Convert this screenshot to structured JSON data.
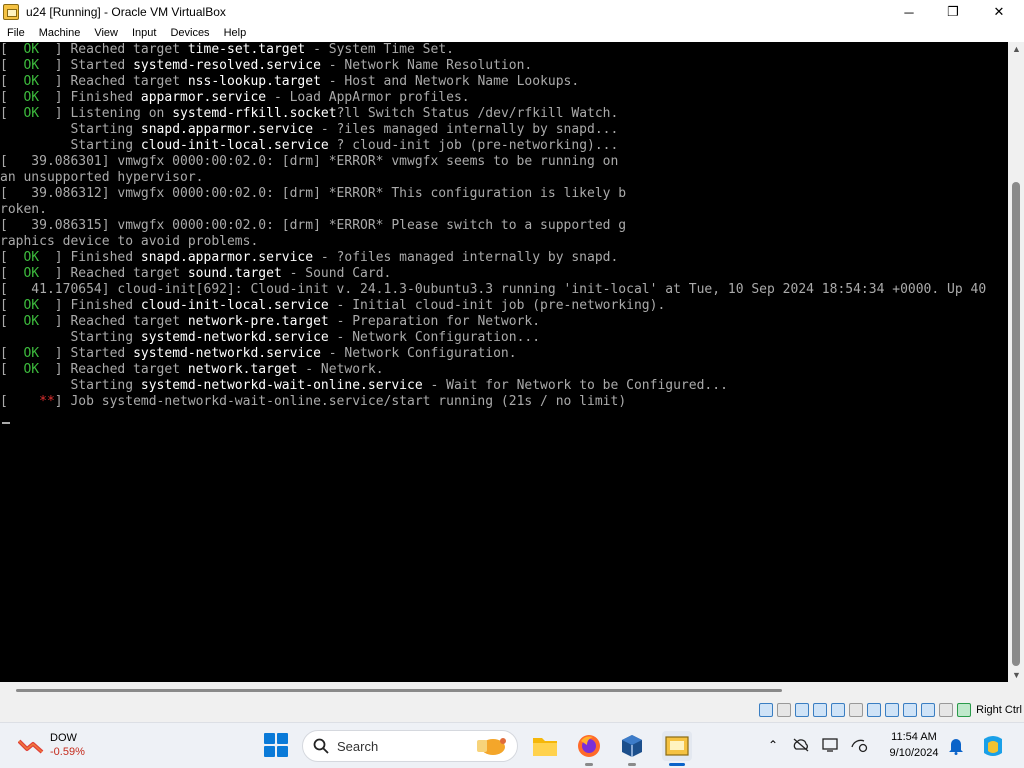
{
  "window": {
    "title": "u24 [Running] - Oracle VM VirtualBox",
    "controls": {
      "minimize": "─",
      "maximize": "❐",
      "close": "✕"
    }
  },
  "menu": [
    "File",
    "Machine",
    "View",
    "Input",
    "Devices",
    "Help"
  ],
  "console": {
    "lines": [
      [
        [
          "[  ",
          ""
        ],
        [
          "OK",
          "ok"
        ],
        [
          "  ] Reached target ",
          ""
        ],
        [
          "time-set.target",
          "hl"
        ],
        [
          " - System Time Set.",
          ""
        ]
      ],
      [
        [
          "[  ",
          ""
        ],
        [
          "OK",
          "ok"
        ],
        [
          "  ] Started ",
          ""
        ],
        [
          "systemd-resolved.service",
          "hl"
        ],
        [
          " - Network Name Resolution.",
          ""
        ]
      ],
      [
        [
          "[  ",
          ""
        ],
        [
          "OK",
          "ok"
        ],
        [
          "  ] Reached target ",
          ""
        ],
        [
          "nss-lookup.target",
          "hl"
        ],
        [
          " - Host and Network Name Lookups.",
          ""
        ]
      ],
      [
        [
          "[  ",
          ""
        ],
        [
          "OK",
          "ok"
        ],
        [
          "  ] Finished ",
          ""
        ],
        [
          "apparmor.service",
          "hl"
        ],
        [
          " - Load AppArmor profiles.",
          ""
        ]
      ],
      [
        [
          "[  ",
          ""
        ],
        [
          "OK",
          "ok"
        ],
        [
          "  ] Listening on ",
          ""
        ],
        [
          "systemd-rfkill.socket",
          "hl"
        ],
        [
          "?ll Switch Status /dev/rfkill Watch.",
          ""
        ]
      ],
      [
        [
          "         Starting ",
          ""
        ],
        [
          "snapd.apparmor.service",
          "hl"
        ],
        [
          " - ?iles managed internally by snapd...",
          ""
        ]
      ],
      [
        [
          "         Starting ",
          ""
        ],
        [
          "cloud-init-local.service",
          "hl"
        ],
        [
          " ? cloud-init job (pre-networking)...",
          ""
        ]
      ],
      [
        [
          "[   39.086301] vmwgfx 0000:00:02.0: [drm] *ERROR* vmwgfx seems to be running on",
          ""
        ]
      ],
      [
        [
          "an unsupported hypervisor.",
          ""
        ]
      ],
      [
        [
          "[   39.086312] vmwgfx 0000:00:02.0: [drm] *ERROR* This configuration is likely b",
          ""
        ]
      ],
      [
        [
          "roken.",
          ""
        ]
      ],
      [
        [
          "[   39.086315] vmwgfx 0000:00:02.0: [drm] *ERROR* Please switch to a supported g",
          ""
        ]
      ],
      [
        [
          "raphics device to avoid problems.",
          ""
        ]
      ],
      [
        [
          "[  ",
          ""
        ],
        [
          "OK",
          "ok"
        ],
        [
          "  ] Finished ",
          ""
        ],
        [
          "snapd.apparmor.service",
          "hl"
        ],
        [
          " - ?ofiles managed internally by snapd.",
          ""
        ]
      ],
      [
        [
          "[  ",
          ""
        ],
        [
          "OK",
          "ok"
        ],
        [
          "  ] Reached target ",
          ""
        ],
        [
          "sound.target",
          "hl"
        ],
        [
          " - Sound Card.",
          ""
        ]
      ],
      [
        [
          "[   41.170654] cloud-init[692]: Cloud-init v. 24.1.3-0ubuntu3.3 running 'init-local' at Tue, 10 Sep 2024 18:54:34 +0000. Up 40",
          ""
        ]
      ],
      [
        [
          "[  ",
          ""
        ],
        [
          "OK",
          "ok"
        ],
        [
          "  ] Finished ",
          ""
        ],
        [
          "cloud-init-local.service",
          "hl"
        ],
        [
          " - Initial cloud-init job (pre-networking).",
          ""
        ]
      ],
      [
        [
          "[  ",
          ""
        ],
        [
          "OK",
          "ok"
        ],
        [
          "  ] Reached target ",
          ""
        ],
        [
          "network-pre.target",
          "hl"
        ],
        [
          " - Preparation for Network.",
          ""
        ]
      ],
      [
        [
          "         Starting ",
          ""
        ],
        [
          "systemd-networkd.service",
          "hl"
        ],
        [
          " - Network Configuration...",
          ""
        ]
      ],
      [
        [
          "[  ",
          ""
        ],
        [
          "OK",
          "ok"
        ],
        [
          "  ] Started ",
          ""
        ],
        [
          "systemd-networkd.service",
          "hl"
        ],
        [
          " - Network Configuration.",
          ""
        ]
      ],
      [
        [
          "[  ",
          ""
        ],
        [
          "OK",
          "ok"
        ],
        [
          "  ] Reached target ",
          ""
        ],
        [
          "network.target",
          "hl"
        ],
        [
          " - Network.",
          ""
        ]
      ],
      [
        [
          "         Starting ",
          ""
        ],
        [
          "systemd-networkd-wait-online.service",
          "hl"
        ],
        [
          " - Wait for Network to be Configured...",
          ""
        ]
      ],
      [
        [
          "[    ",
          ""
        ],
        [
          "**",
          "red"
        ],
        [
          "] Job systemd-networkd-wait-online.service/start running (21s / no limit)",
          ""
        ]
      ]
    ]
  },
  "statusbar": {
    "icons": [
      "hard-disk-icon",
      "optical-drive-icon",
      "audio-icon",
      "network-icon",
      "usb-icon",
      "shared-folder-icon",
      "display-icon",
      "recording-icon",
      "vt-x-icon",
      "cpu-icon",
      "mouse-integration-icon",
      "keyboard-capture-icon"
    ],
    "host_key": "Right Ctrl"
  },
  "taskbar": {
    "widget": {
      "name": "DOW",
      "change": "-0.59%",
      "color": "#c42b1c"
    },
    "search_label": "Search",
    "apps": [
      "file-explorer-icon",
      "firefox-icon",
      "virtualbox-icon",
      "virtualbox-vm-icon"
    ],
    "clock": {
      "time": "11:54 AM",
      "date": "9/10/2024"
    }
  }
}
